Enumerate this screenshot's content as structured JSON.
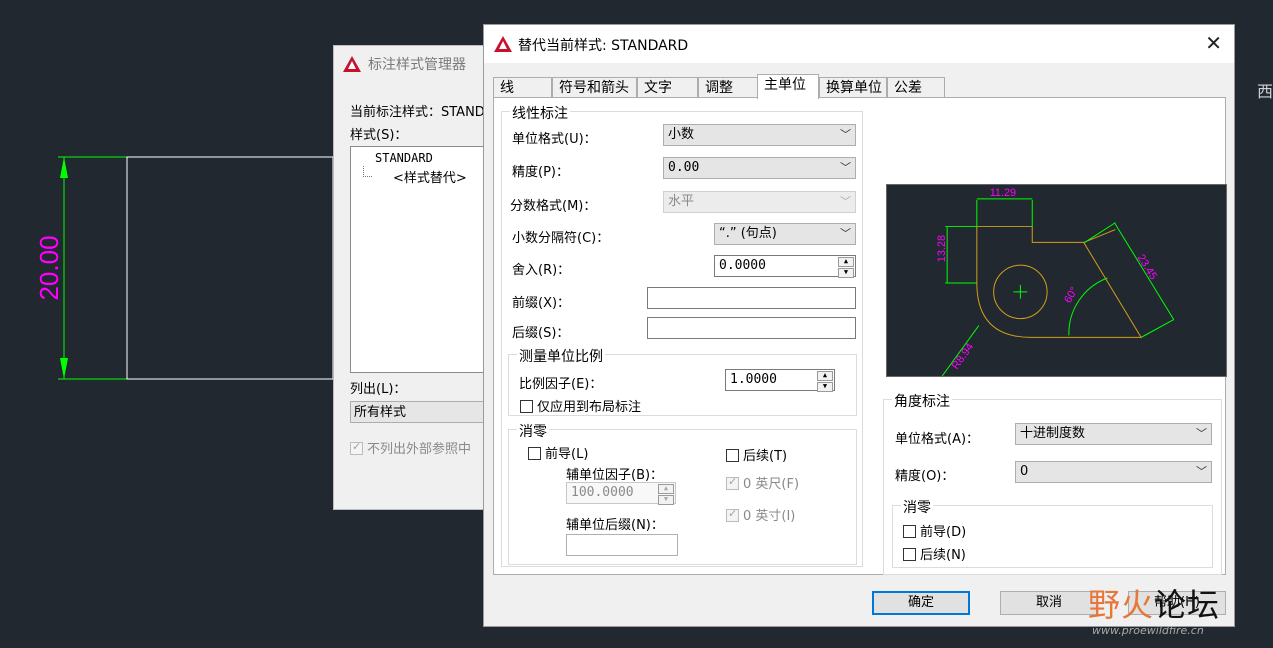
{
  "cad": {
    "dim_text": "20.00",
    "side_text": "西",
    "colors": {
      "background": "#212830",
      "dimension": "#ff00ff",
      "dim_lines": "#00ff00",
      "geometry": "#ffffff"
    }
  },
  "manager": {
    "title": "标注样式管理器",
    "current_style_label": "当前标注样式：STANDARD",
    "styles_label": "样式(S)：",
    "styles": [
      "STANDARD",
      "<样式替代>"
    ],
    "list_label": "列出(L)：",
    "list_value": "所有样式",
    "xref_checkbox": "不列出外部参照中"
  },
  "dialog": {
    "title": "替代当前样式: STANDARD",
    "tabs": [
      "线",
      "符号和箭头",
      "文字",
      "调整",
      "主单位",
      "换算单位",
      "公差"
    ],
    "active_tab": "主单位",
    "linear": {
      "group_title": "线性标注",
      "unit_format_label": "单位格式(U)：",
      "unit_format_value": "小数",
      "precision_label": "精度(P)：",
      "precision_value": "0.00",
      "fraction_label": "分数格式(M)：",
      "fraction_value": "水平",
      "decimal_sep_label": "小数分隔符(C)：",
      "decimal_sep_value": "“.” (句点)",
      "round_label": "舍入(R)：",
      "round_value": "0.0000",
      "prefix_label": "前缀(X)：",
      "prefix_value": "",
      "suffix_label": "后缀(S)：",
      "suffix_value": ""
    },
    "scale": {
      "group_title": "测量单位比例",
      "factor_label": "比例因子(E)：",
      "factor_value": "1.0000",
      "layout_only": "仅应用到布局标注"
    },
    "zero": {
      "group_title": "消零",
      "leading": "前导(L)",
      "sub_factor_label": "辅单位因子(B)：",
      "sub_factor_value": "100.0000",
      "sub_suffix_label": "辅单位后缀(N)：",
      "sub_suffix_value": "",
      "trailing": "后续(T)",
      "feet": "0 英尺(F)",
      "inches": "0 英寸(I)"
    },
    "preview": {
      "dims": [
        "11.29",
        "13.28",
        "23.45",
        "60°",
        "R8.94"
      ],
      "colors": {
        "geometry": "#d4a017",
        "dimension": "#00ff00",
        "text": "#ff00ff",
        "center": "#00ff00"
      }
    },
    "angular": {
      "group_title": "角度标注",
      "unit_format_label": "单位格式(A)：",
      "unit_format_value": "十进制度数",
      "precision_label": "精度(O)：",
      "precision_value": "0",
      "zero_title": "消零",
      "leading": "前导(D)",
      "trailing": "后续(N)"
    },
    "buttons": {
      "ok": "确定",
      "cancel": "取消",
      "help": "帮助(H)"
    }
  },
  "watermark": {
    "brand_a": "野火",
    "brand_b": "论坛",
    "url": "www.proewildfire.cn"
  }
}
